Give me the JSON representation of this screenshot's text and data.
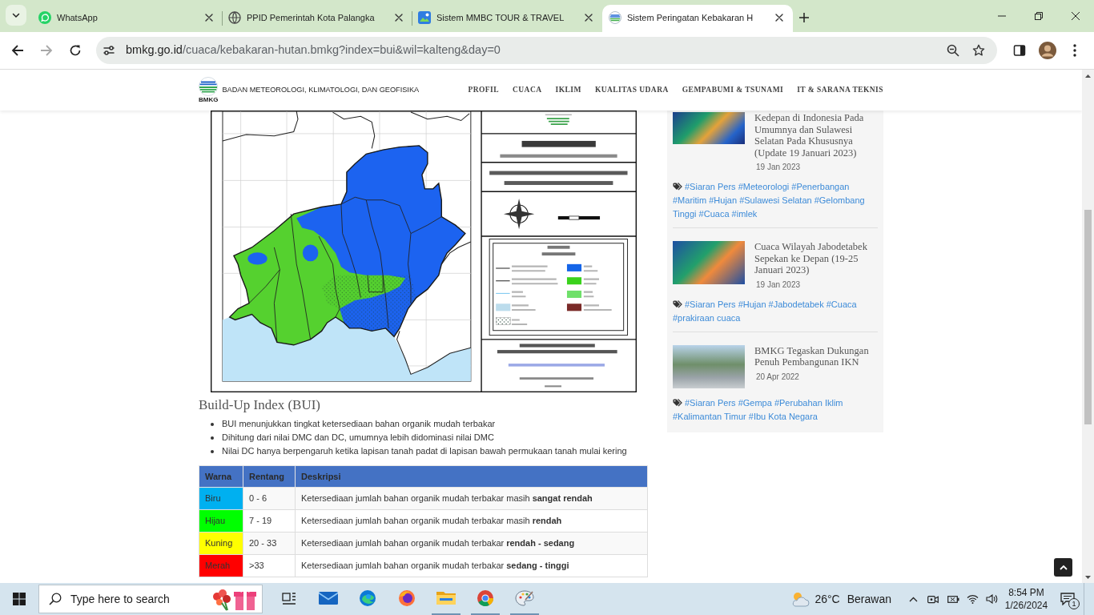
{
  "browser": {
    "tabs": [
      {
        "title": "WhatsApp",
        "selected": false
      },
      {
        "title": "PPID Pemerintah Kota Palangka",
        "selected": false
      },
      {
        "title": "Sistem MMBC TOUR & TRAVEL",
        "selected": false
      },
      {
        "title": "Sistem Peringatan Kebakaran H",
        "selected": true
      }
    ],
    "back": {
      "disabled": false
    },
    "forward": {
      "disabled": true
    },
    "address": {
      "host": "bmkg.go.id",
      "path": "/cuaca/kebakaran-hutan.bmkg?index=bui&wil=kalteng&day=0"
    }
  },
  "site_header": {
    "logo_text": "BMKG",
    "name": "BADAN METEOROLOGI, KLIMATOLOGI, DAN GEOFISIKA",
    "nav": [
      "PROFIL",
      "CUACA",
      "IKLIM",
      "KUALITAS UDARA",
      "GEMPABUMI & TSUNAMI",
      "IT & SARANA TEKNIS"
    ]
  },
  "article": {
    "heading": "Build-Up Index (BUI)",
    "bullets": [
      "BUI menunjukkan tingkat ketersediaan bahan organik mudah terbakar",
      "Dihitung dari nilai DMC dan DC, umumnya lebih didominasi nilai DMC",
      "Nilai DC hanya berpengaruh ketika lapisan tanah padat di lapisan bawah permukaan tanah mulai kering"
    ],
    "table": {
      "columns": [
        "Warna",
        "Rentang",
        "Deskripsi"
      ],
      "rows": [
        {
          "color": "#00b0f0",
          "warna": "Biru",
          "rentang": "0 - 6",
          "deskripsi": "Ketersediaan jumlah bahan organik mudah terbakar masih **sangat rendah**"
        },
        {
          "color": "#00ff00",
          "warna": "Hijau",
          "rentang": "7 - 19",
          "deskripsi": "Ketersediaan jumlah bahan organik mudah terbakar masih **rendah**"
        },
        {
          "color": "#ffff00",
          "warna": "Kuning",
          "rentang": "20 - 33",
          "deskripsi": "Ketersediaan jumlah bahan organik mudah terbakar **rendah - sedang**"
        },
        {
          "color": "#ff0000",
          "warna": "Merah",
          "rentang": ">33",
          "deskripsi": "Ketersediaan jumlah bahan organik mudah terbakar **sedang - tinggi**"
        }
      ]
    }
  },
  "sidebar": {
    "posts": [
      {
        "title": "Kedepan di Indonesia Pada Umumnya dan Sulawesi Selatan Pada Khususnya (Update 19 Januari 2023)",
        "date": "19 Jan 2023",
        "tags": "#Siaran Pers #Meteorologi #Penerbangan #Maritim #Hujan #Sulawesi Selatan #Gelombang Tinggi #Cuaca #imlek"
      },
      {
        "title": "Cuaca Wilayah Jabodetabek Sepekan ke Depan (19-25 Januari 2023)",
        "date": "19 Jan 2023",
        "tags": "#Siaran Pers #Hujan #Jabodetabek #Cuaca #prakiraan cuaca"
      },
      {
        "title": "BMKG Tegaskan Dukungan Penuh Pembangunan IKN",
        "date": "20 Apr 2022",
        "tags": "#Siaran Pers #Gempa #Perubahan Iklim #Kalimantan Timur #Ibu Kota Negara"
      }
    ]
  },
  "taskbar": {
    "search": {
      "placeholder": "Type here to search"
    },
    "apps": [
      {
        "running": false
      },
      {
        "running": false
      },
      {
        "running": false
      },
      {
        "running": true
      },
      {
        "running": true
      },
      {
        "running": true
      }
    ],
    "weather": {
      "temperature": "26°C",
      "condition": "Berawan"
    },
    "clock": {
      "time": "8:54 PM",
      "date": "1/26/2024"
    },
    "notifications": {
      "count": "1"
    }
  }
}
